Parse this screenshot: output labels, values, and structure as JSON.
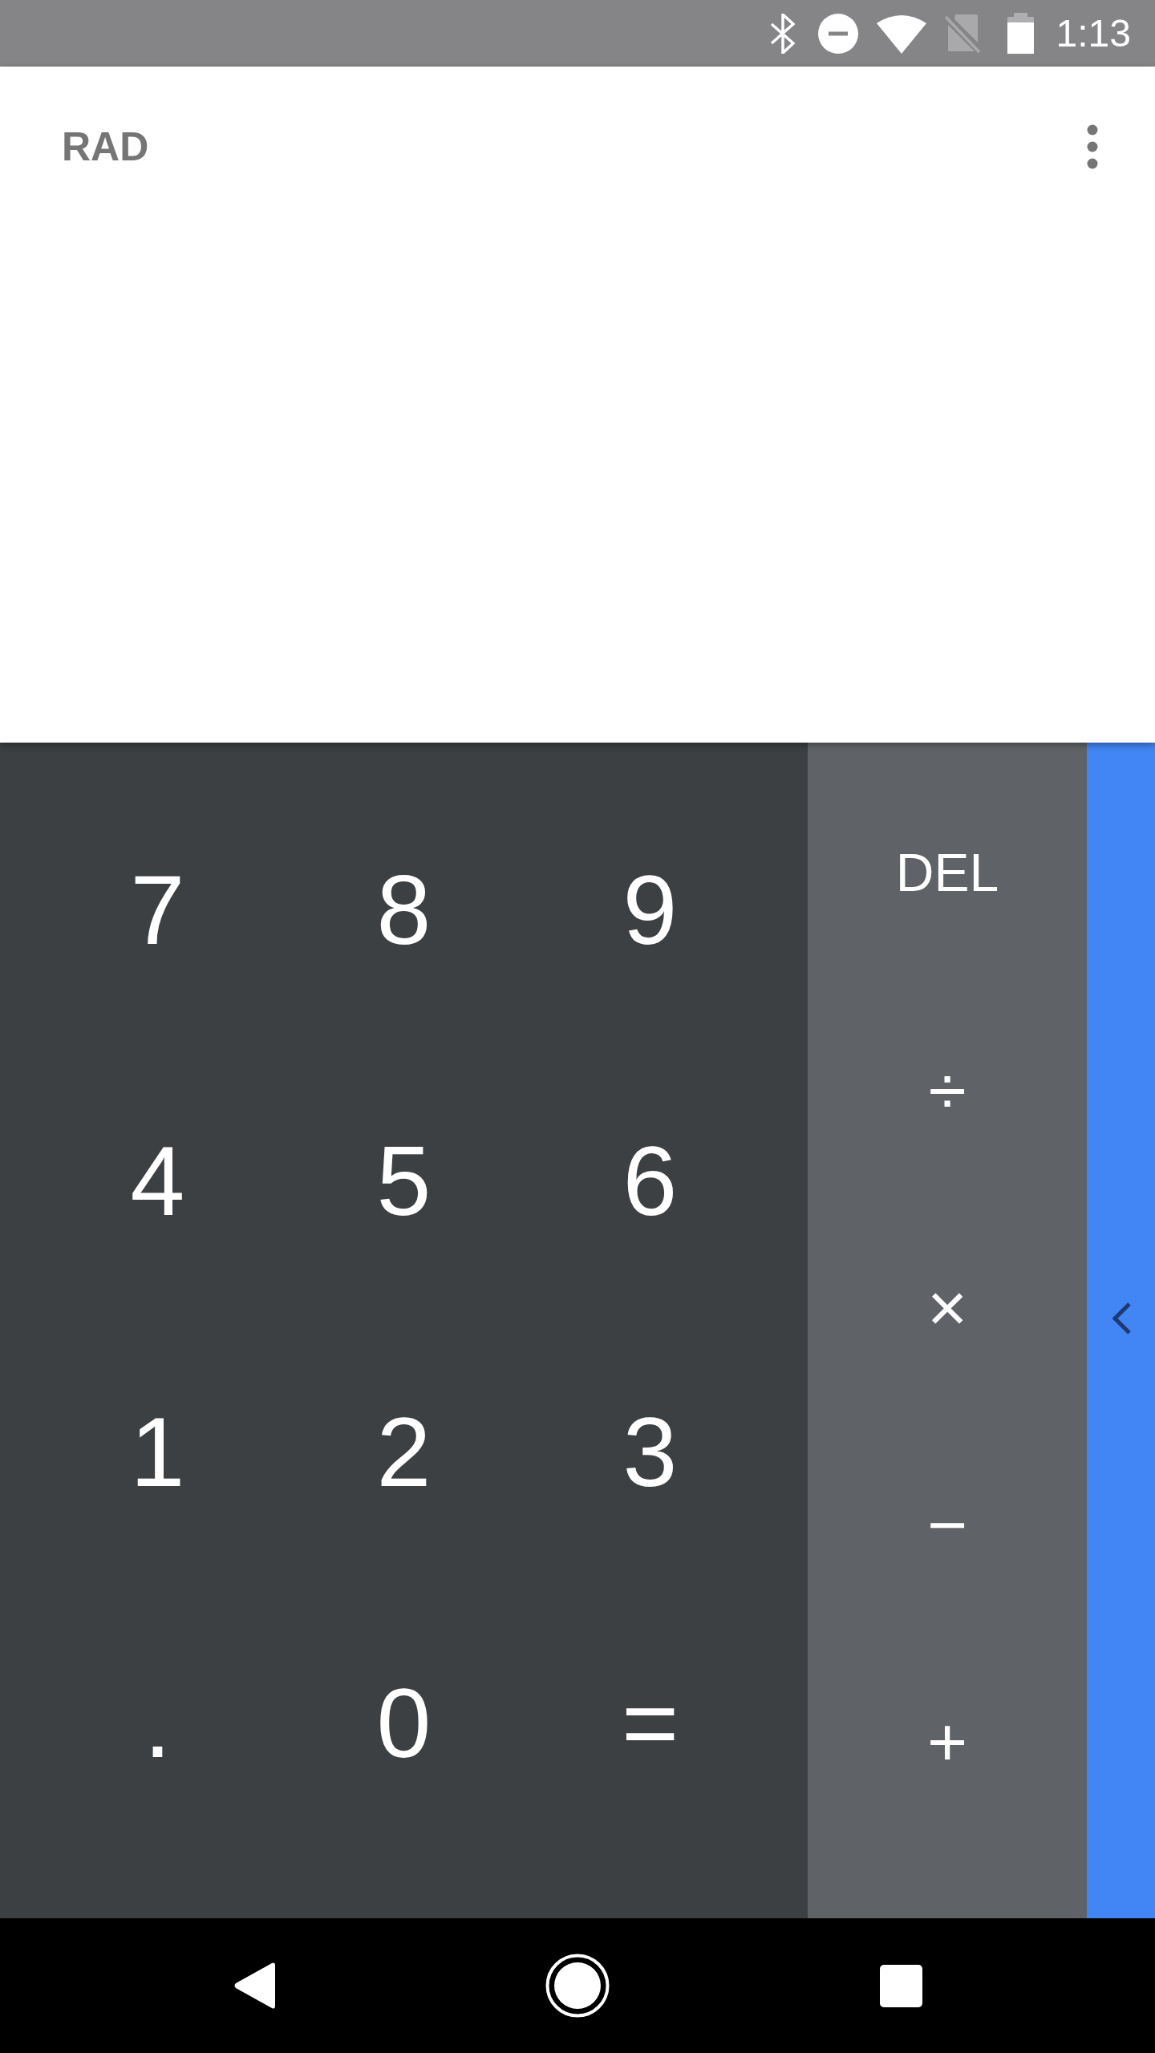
{
  "status_bar": {
    "time": "1:13"
  },
  "display": {
    "angle_mode": "RAD"
  },
  "digit_keys": [
    {
      "label": "7"
    },
    {
      "label": "8"
    },
    {
      "label": "9"
    },
    {
      "label": "4"
    },
    {
      "label": "5"
    },
    {
      "label": "6"
    },
    {
      "label": "1"
    },
    {
      "label": "2"
    },
    {
      "label": "3"
    },
    {
      "label": "."
    },
    {
      "label": "0"
    },
    {
      "label": "="
    }
  ],
  "operator_keys": [
    {
      "label": "DEL",
      "kind": "word"
    },
    {
      "label": "÷",
      "kind": "symbol"
    },
    {
      "label": "×",
      "kind": "symbol"
    },
    {
      "label": "−",
      "kind": "symbol"
    },
    {
      "label": "+",
      "kind": "symbol"
    }
  ],
  "advanced_panel": {
    "expanded": false
  }
}
